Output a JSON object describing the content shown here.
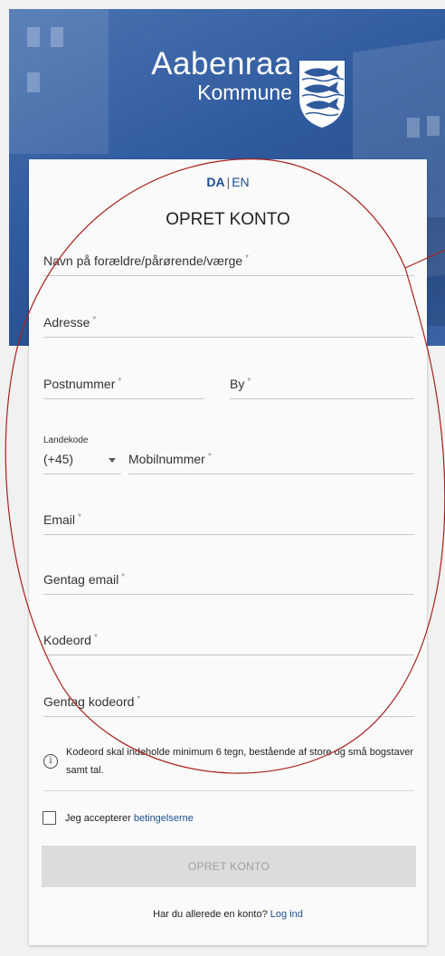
{
  "header": {
    "logo_line1": "Aabenraa",
    "logo_line2": "Kommune"
  },
  "lang": {
    "da": "DA",
    "sep": "|",
    "en": "EN"
  },
  "form": {
    "title": "OPRET KONTO",
    "guardian_label": "Navn på forældre/pårørende/værge",
    "address_label": "Adresse",
    "postal_label": "Postnummer",
    "city_label": "By",
    "country_code_label": "Landekode",
    "country_code_value": "(+45)",
    "mobile_label": "Mobilnummer",
    "email_label": "Email",
    "email_repeat_label": "Gentag email",
    "password_label": "Kodeord",
    "password_repeat_label": "Gentag kodeord",
    "required_mark": "*",
    "password_hint": "Kodeord skal indeholde minimum 6 tegn, bestående af store og små bogstaver samt tal.",
    "terms_prefix": "Jeg accepterer",
    "terms_link": "betingelserne",
    "submit_label": "OPRET KONTO",
    "login_prompt": "Har du allerede en konto?",
    "login_link": "Log ind"
  },
  "colors": {
    "brand_blue": "#2f5a9e",
    "link_blue": "#1a4f93",
    "annotation_red": "#a8211c"
  },
  "icons": {
    "info": "info-icon",
    "shield": "coat-of-arms-fish-icon",
    "dropdown": "caret-down-icon"
  }
}
